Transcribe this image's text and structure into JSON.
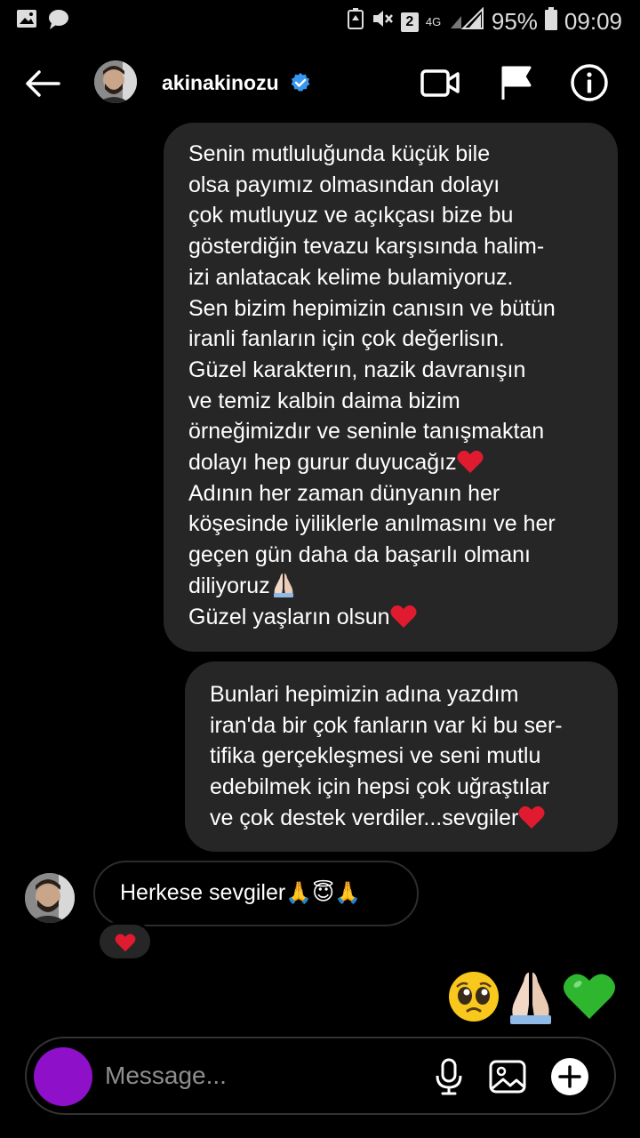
{
  "status_bar": {
    "battery": "95%",
    "time": "09:09",
    "sim_slot": "2",
    "network": "4G"
  },
  "header": {
    "username": "akinakinozu"
  },
  "messages": {
    "sent_1": [
      "Senin mutluluğunda küçük bile",
      "olsa payımız olmasından dolayı",
      "çok mutluyuz ve açıkçası bize bu",
      "gösterdiğin tevazu karşısında halim-",
      "izi anlatacak kelime bulamiyoruz.",
      "Sen bizim hepimizin canısın ve bütün",
      "iranli fanların için çok değerlisın.",
      "Güzel karakterın, nazik davranışın",
      "ve temiz kalbin daima bizim",
      "örneğimizdır ve seninle tanışmaktan",
      "dolayı hep gurur duyucağız",
      "Adının her zaman dünyanın her",
      "köşesinde iyiliklerle anılmasını ve her",
      "geçen gün daha da başarılı olmanı",
      "diliyoruz",
      "Güzel yaşların olsun"
    ],
    "sent_2": [
      "Bunlari hepimizin adına yazdım",
      "iran'da bir çok fanların var ki bu ser-",
      "tifika gerçekleşmesi ve seni mutlu",
      "edebilmek için hepsi çok uğraştılar",
      "ve çok destek verdiler...sevgiler"
    ],
    "received": {
      "text": "Herkese sevgiler",
      "emoji": "🙏😇🙏"
    },
    "reaction": "red-heart",
    "last_sent_emojis": [
      "pleading-face",
      "folded-hands",
      "green-heart"
    ]
  },
  "composer": {
    "placeholder": "Message..."
  },
  "colors": {
    "background": "#000000",
    "bubble": "#262626",
    "heart_red": "#e01b2f",
    "green_heart": "#2fb62f",
    "camera_button": "#8e10c9",
    "verified_blue": "#3897f0"
  }
}
